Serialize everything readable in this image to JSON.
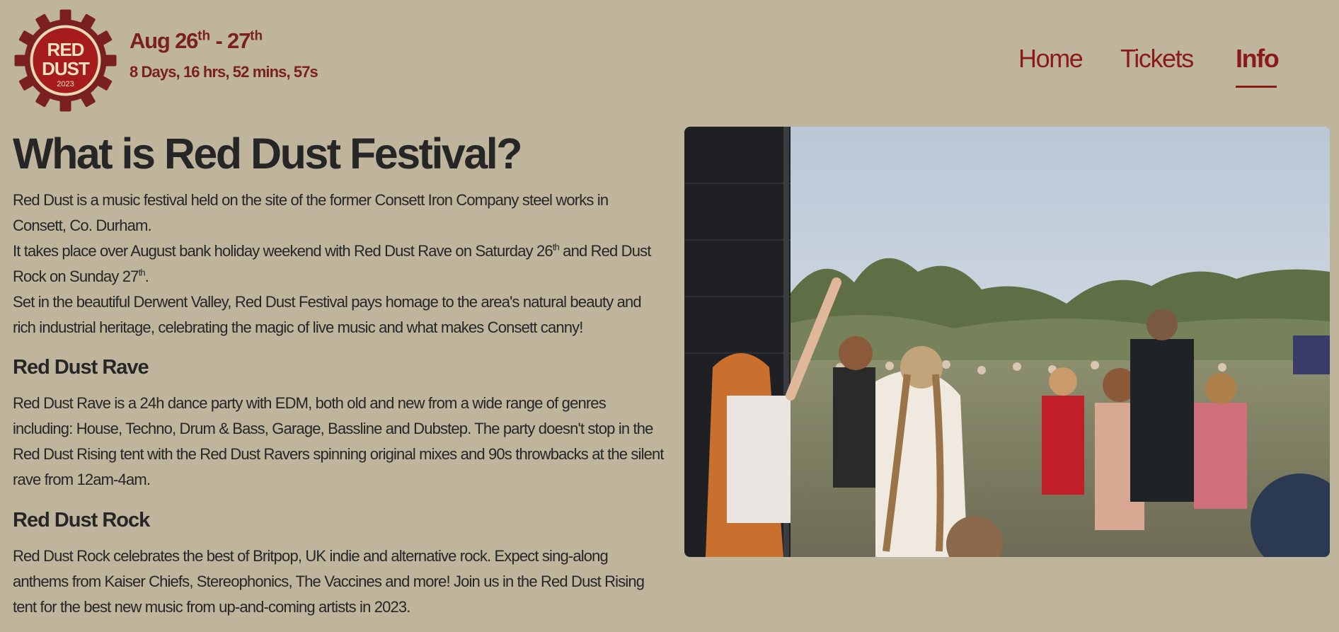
{
  "brand": {
    "logo_line1": "RED",
    "logo_line2": "DUST",
    "logo_year": "2023",
    "color_primary": "#8b1a1a",
    "color_logo_ring": "#7a2020",
    "color_logo_cream": "#e8d9b4",
    "background": "#bfb59c"
  },
  "header": {
    "date_start": "Aug 26",
    "date_start_sup": "th",
    "date_sep": " - 27",
    "date_end_sup": "th",
    "countdown": "8 Days, 16 hrs, 52 mins, 57s"
  },
  "nav": {
    "items": [
      {
        "label": "Home",
        "active": false
      },
      {
        "label": "Tickets",
        "active": false
      },
      {
        "label": "Info",
        "active": true
      }
    ]
  },
  "main": {
    "title": "What is Red Dust Festival?",
    "intro_p1": "Red Dust is a music festival held on the site of the former Consett Iron Company steel works in Consett, Co. Durham.",
    "intro_p2_a": "It takes place over August bank holiday weekend with Red Dust Rave on Saturday 26",
    "intro_p2_sup1": "th",
    "intro_p2_b": " and Red Dust Rock on Sunday 27",
    "intro_p2_sup2": "th",
    "intro_p2_c": ".",
    "intro_p3": "Set in the beautiful Derwent Valley, Red Dust Festival pays homage to the area's natural beauty and rich industrial heritage, celebrating the magic of live music and what makes Consett canny!",
    "rave_heading": "Red Dust Rave",
    "rave_text": "Red Dust Rave is a 24h dance party with EDM, both old and new from a wide range of genres including: House, Techno, Drum & Bass, Garage, Bassline and Dubstep. The party doesn't stop in the Red Dust Rising tent with the Red Dust Ravers spinning original mixes and 90s throwbacks at the silent rave from 12am-4am.",
    "rock_heading": "Red Dust Rock",
    "rock_text": "Red Dust Rock celebrates the best of Britpop, UK indie and alternative rock. Expect sing-along anthems from Kaiser Chiefs, Stereophonics, The Vaccines and more! Join us in the Red Dust Rising tent for the best new music from up-and-coming artists in 2023."
  }
}
